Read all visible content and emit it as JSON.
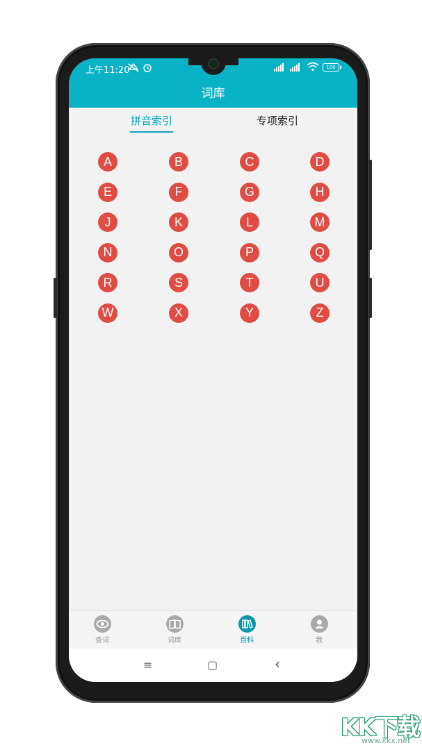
{
  "status": {
    "time": "上午11:20",
    "battery": "100"
  },
  "header": {
    "title": "词库"
  },
  "tabs": [
    {
      "label": "拼音索引",
      "active": true
    },
    {
      "label": "专项索引",
      "active": false
    }
  ],
  "letters": [
    "A",
    "B",
    "C",
    "D",
    "E",
    "F",
    "G",
    "H",
    "J",
    "K",
    "L",
    "M",
    "N",
    "O",
    "P",
    "Q",
    "R",
    "S",
    "T",
    "U",
    "W",
    "X",
    "Y",
    "Z"
  ],
  "bottom_nav": [
    {
      "label": "查词",
      "icon": "eye-icon",
      "active": false
    },
    {
      "label": "词库",
      "icon": "book-icon",
      "active": false
    },
    {
      "label": "百科",
      "icon": "bookshelf-icon",
      "active": true
    },
    {
      "label": "我",
      "icon": "person-icon",
      "active": false
    }
  ],
  "system_nav": {
    "menu": "≡",
    "home": "▢",
    "back": "‹"
  },
  "watermark": {
    "text": "KK下载",
    "url": "www.kkx.net"
  },
  "colors": {
    "accent": "#08b3c6",
    "letter_bg": "#e04b43",
    "active_nav": "#0b97a9"
  }
}
